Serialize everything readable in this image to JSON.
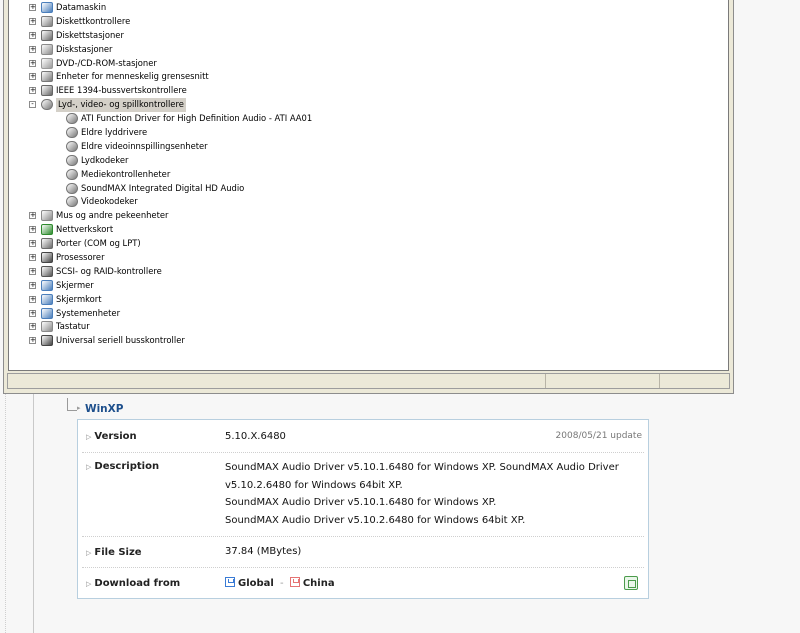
{
  "device_manager": {
    "tree": [
      {
        "label": "Datamaskin",
        "level": 0,
        "expander": "+",
        "icon": "computer-icon",
        "color": "#4a7ebb"
      },
      {
        "label": "Diskettkontrollere",
        "level": 0,
        "expander": "+",
        "icon": "floppy-controller-icon",
        "color": "#7d7d7d"
      },
      {
        "label": "Diskettstasjoner",
        "level": 0,
        "expander": "+",
        "icon": "floppy-drive-icon",
        "color": "#6b6b6b"
      },
      {
        "label": "Diskstasjoner",
        "level": 0,
        "expander": "+",
        "icon": "disk-drive-icon",
        "color": "#8a8a8a"
      },
      {
        "label": "DVD-/CD-ROM-stasjoner",
        "level": 0,
        "expander": "+",
        "icon": "cdrom-icon",
        "color": "#9a9a9a"
      },
      {
        "label": "Enheter for menneskelig grensesnitt",
        "level": 0,
        "expander": "+",
        "icon": "hid-icon",
        "color": "#777777"
      },
      {
        "label": "IEEE 1394-bussvertskontrollere",
        "level": 0,
        "expander": "+",
        "icon": "firewire-icon",
        "color": "#666666"
      },
      {
        "label": "Lyd-, video- og spillkontrollere",
        "level": 0,
        "expander": "−",
        "icon": "sound-icon",
        "color": "#777777",
        "selected": true
      },
      {
        "label": "ATI Function Driver for High Definition Audio - ATI AA01",
        "level": 1,
        "icon": "sound-device-icon",
        "color": "#777777"
      },
      {
        "label": "Eldre lyddrivere",
        "level": 1,
        "icon": "sound-device-icon",
        "color": "#777777"
      },
      {
        "label": "Eldre videoinnspillingsenheter",
        "level": 1,
        "icon": "sound-device-icon",
        "color": "#777777"
      },
      {
        "label": "Lydkodeker",
        "level": 1,
        "icon": "sound-device-icon",
        "color": "#777777"
      },
      {
        "label": "Mediekontrollenheter",
        "level": 1,
        "icon": "sound-device-icon",
        "color": "#777777"
      },
      {
        "label": "SoundMAX Integrated Digital HD Audio",
        "level": 1,
        "icon": "sound-device-icon",
        "color": "#777777"
      },
      {
        "label": "Videokodeker",
        "level": 1,
        "icon": "sound-device-icon",
        "color": "#777777"
      },
      {
        "label": "Mus og andre pekeenheter",
        "level": 0,
        "expander": "+",
        "icon": "mouse-icon",
        "color": "#8a8a8a"
      },
      {
        "label": "Nettverkskort",
        "level": 0,
        "expander": "+",
        "icon": "network-card-icon",
        "color": "#2e8b2e"
      },
      {
        "label": "Porter (COM og LPT)",
        "level": 0,
        "expander": "+",
        "icon": "port-icon",
        "color": "#6b6b6b"
      },
      {
        "label": "Prosessorer",
        "level": 0,
        "expander": "+",
        "icon": "processor-icon",
        "color": "#444444"
      },
      {
        "label": "SCSI- og RAID-kontrollere",
        "level": 0,
        "expander": "+",
        "icon": "scsi-icon",
        "color": "#555555"
      },
      {
        "label": "Skjermer",
        "level": 0,
        "expander": "+",
        "icon": "monitor-icon",
        "color": "#4a7ebb"
      },
      {
        "label": "Skjermkort",
        "level": 0,
        "expander": "+",
        "icon": "display-adapter-icon",
        "color": "#4a7ebb"
      },
      {
        "label": "Systemenheter",
        "level": 0,
        "expander": "+",
        "icon": "system-device-icon",
        "color": "#4a7ebb"
      },
      {
        "label": "Tastatur",
        "level": 0,
        "expander": "+",
        "icon": "keyboard-icon",
        "color": "#8a8a8a"
      },
      {
        "label": "Universal seriell busskontroller",
        "level": 0,
        "expander": "+",
        "icon": "usb-icon",
        "color": "#444444"
      }
    ]
  },
  "os_section": {
    "title": "WinXP"
  },
  "info": {
    "version_label": "Version",
    "version_value": "5.10.X.6480",
    "update_note": "2008/05/21 update",
    "description_label": "Description",
    "description_lines": [
      "SoundMAX Audio Driver v5.10.1.6480 for Windows XP. SoundMAX Audio Driver",
      "v5.10.2.6480 for Windows 64bit XP.",
      "SoundMAX Audio Driver v5.10.1.6480 for Windows XP.",
      "SoundMAX Audio Driver v5.10.2.6480 for Windows 64bit XP."
    ],
    "filesize_label": "File Size",
    "filesize_value": "37.84 (MBytes)",
    "download_label": "Download from",
    "download_global": "Global",
    "download_separator": "-",
    "download_china": "China"
  },
  "colors": {
    "heading": "#1d4f8c",
    "table_border": "#b8cfdf",
    "selected_bg": "#d4d0c8"
  }
}
